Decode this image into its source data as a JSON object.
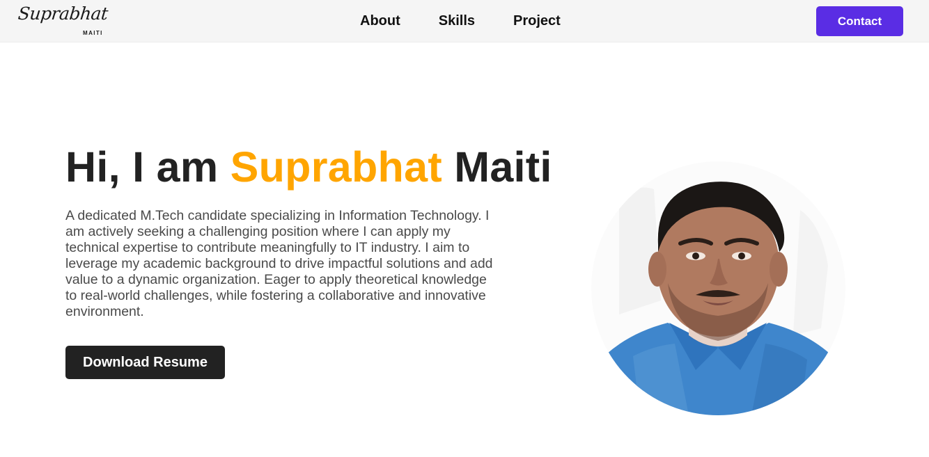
{
  "brand": {
    "logo_script": "Suprabhat",
    "logo_sub": "MAITI"
  },
  "nav": {
    "items": [
      {
        "label": "About"
      },
      {
        "label": "Skills"
      },
      {
        "label": "Project"
      }
    ],
    "contact_label": "Contact"
  },
  "hero": {
    "greeting": "Hi, I am",
    "first_name": "Suprabhat",
    "last_name": "Maiti",
    "description": "A dedicated M.Tech candidate specializing in Information Technology. I am actively seeking a challenging position where I can apply my technical expertise to contribute meaningfully to IT industry. I aim to leverage my academic background to drive impactful solutions and add value to a dynamic organization. Eager to apply theoretical knowledge to real-world challenges, while fostering a collaborative and innovative environment.",
    "resume_label": "Download Resume"
  },
  "colors": {
    "accent": "#ffa500",
    "primary_button": "#5a2de4",
    "dark_button": "#222222",
    "navbar_bg": "#f5f5f5"
  }
}
